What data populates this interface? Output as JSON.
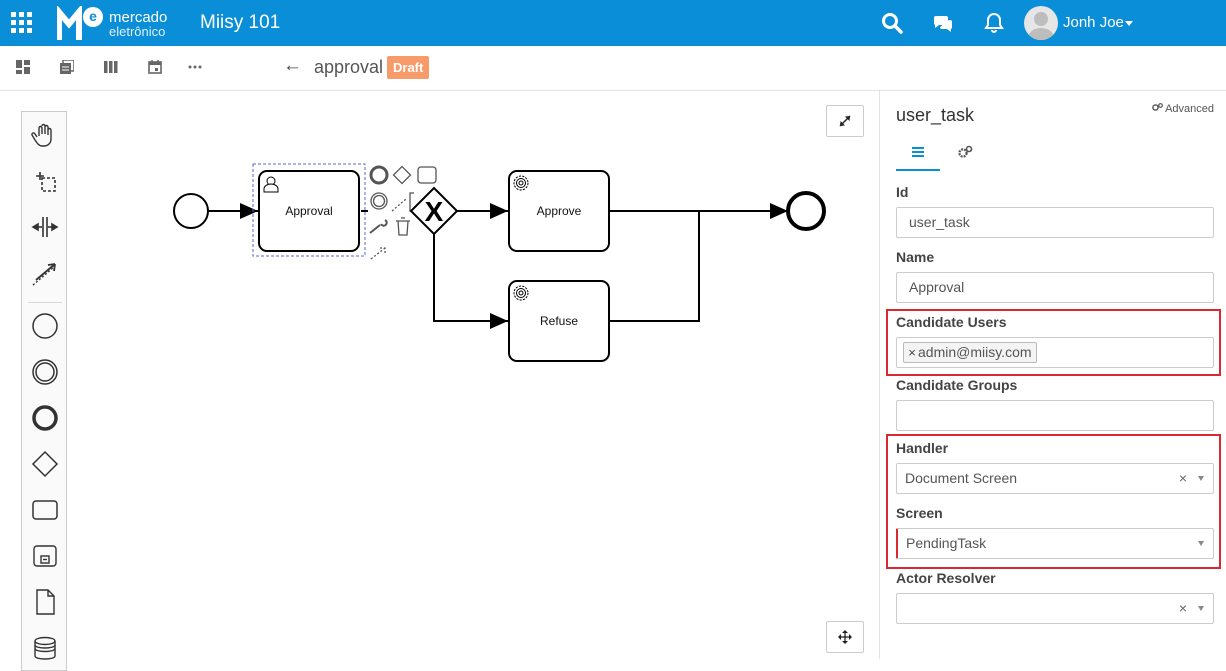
{
  "header": {
    "logo_line1": "mercado",
    "logo_line2": "eletrônico",
    "logo_mark": "e",
    "app_title": "Miisy 101",
    "user_name": "Jonh Joe"
  },
  "toolbar": {
    "back_arrow": "←",
    "title": "approval",
    "badge": "Draft"
  },
  "diagram": {
    "tasks": [
      {
        "label": "Approval",
        "type": "user-task"
      },
      {
        "label": "Approve",
        "type": "service-task"
      },
      {
        "label": "Refuse",
        "type": "service-task"
      }
    ],
    "gateway_mark": "X"
  },
  "panel": {
    "title": "user_task",
    "advanced_label": "Advanced",
    "fields": {
      "id_label": "Id",
      "id_value": "user_task",
      "name_label": "Name",
      "name_value": "Approval",
      "candidate_users_label": "Candidate Users",
      "candidate_users_tags": [
        "admin@miisy.com"
      ],
      "candidate_groups_label": "Candidate Groups",
      "handler_label": "Handler",
      "handler_value": "Document Screen",
      "screen_label": "Screen",
      "screen_value": "PendingTask",
      "actor_resolver_label": "Actor Resolver"
    },
    "clear_glyph": "×"
  },
  "colors": {
    "header_bg": "#0b8ed8",
    "draft_badge": "#f79b6b",
    "highlight_border": "#d9282f",
    "active_tab": "#0b8ed8"
  }
}
